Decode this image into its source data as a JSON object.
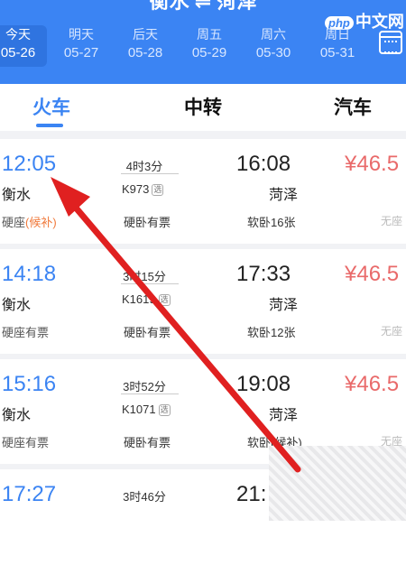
{
  "header": {
    "title": "衡水 ⇌ 菏泽",
    "dates": [
      {
        "label": "今天",
        "date": "05-26",
        "active": true
      },
      {
        "label": "明天",
        "date": "05-27"
      },
      {
        "label": "后天",
        "date": "05-28"
      },
      {
        "label": "周五",
        "date": "05-29"
      },
      {
        "label": "周六",
        "date": "05-30"
      },
      {
        "label": "周日",
        "date": "05-31"
      }
    ],
    "accent": "#3b84f3",
    "calendar_icon": "calendar-icon"
  },
  "watermark": {
    "php": "php",
    "text": "中文网"
  },
  "tabs": [
    {
      "label": "火车",
      "active": true
    },
    {
      "label": "中转"
    },
    {
      "label": "汽车"
    }
  ],
  "trains": [
    {
      "dep_time": "12:05",
      "dep_station": "衡水",
      "seat1": "硬座",
      "seat1_extra": "(候补)",
      "duration": "4时3分",
      "train_no": "K973",
      "badge": "选",
      "seat2": "硬卧有票",
      "arr_time": "16:08",
      "arr_station": "菏泽",
      "seat3": "软卧16张",
      "price": "¥46.5",
      "seat4": "无座"
    },
    {
      "dep_time": "14:18",
      "dep_station": "衡水",
      "seat1": "硬座有票",
      "seat1_extra": "",
      "duration": "3时15分",
      "train_no": "K1619",
      "badge": "选",
      "seat2": "硬卧有票",
      "arr_time": "17:33",
      "arr_station": "菏泽",
      "seat3": "软卧12张",
      "price": "¥46.5",
      "seat4": "无座"
    },
    {
      "dep_time": "15:16",
      "dep_station": "衡水",
      "seat1": "硬座有票",
      "seat1_extra": "",
      "duration": "3时52分",
      "train_no": "K1071",
      "badge": "选",
      "seat2": "硬卧有票",
      "arr_time": "19:08",
      "arr_station": "菏泽",
      "seat3": "软卧(候补)",
      "price": "¥46.5",
      "seat4": "无座"
    },
    {
      "dep_time": "17:27",
      "dep_station": "",
      "seat1": "",
      "seat1_extra": "",
      "duration": "3时46分",
      "train_no": "",
      "badge": "",
      "seat2": "",
      "arr_time": "21:",
      "arr_station": "",
      "seat3": "",
      "price": "",
      "seat4": ""
    }
  ],
  "annotation_color": "#e02020"
}
